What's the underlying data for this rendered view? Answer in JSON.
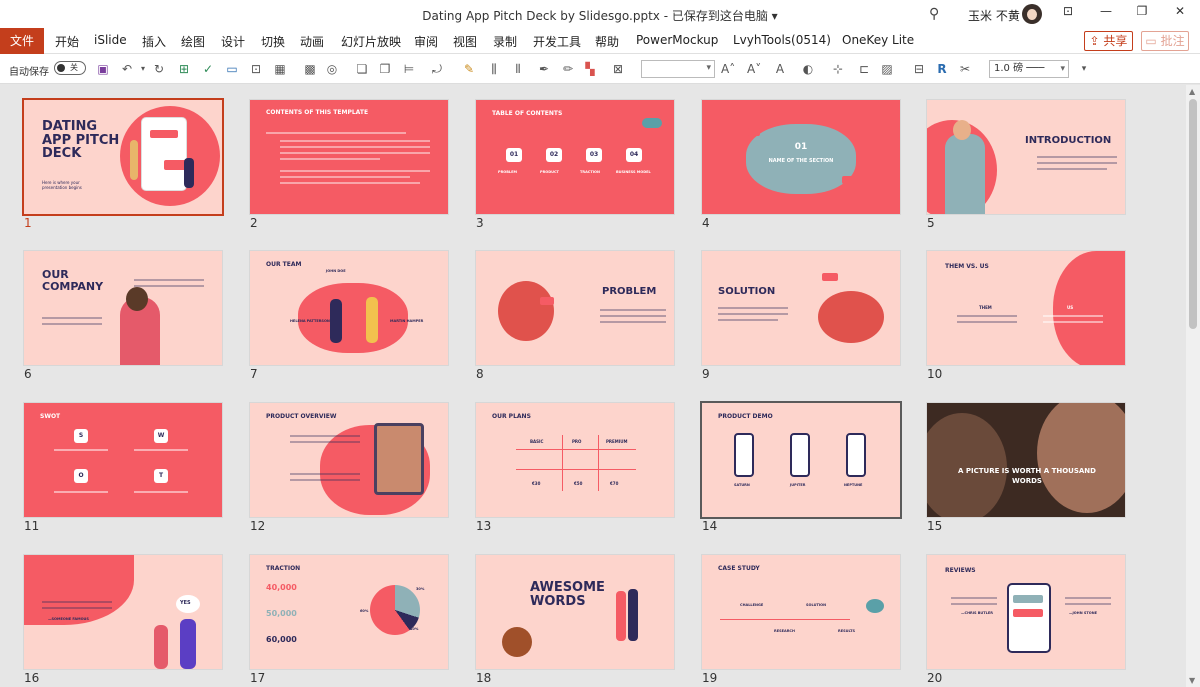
{
  "window": {
    "title": "Dating App Pitch Deck by Slidesgo.pptx  -  已保存到这台电脑 ▾",
    "user": "玉米 不黄"
  },
  "ribbon": {
    "file_tab": "文件",
    "tabs": [
      "开始",
      "iSlide",
      "插入",
      "绘图",
      "设计",
      "切换",
      "动画",
      "幻灯片放映",
      "审阅",
      "视图",
      "录制",
      "开发工具",
      "帮助",
      "PowerMockup",
      "LvyhTools(0514)",
      "OneKey Lite"
    ],
    "share": "共享",
    "comment": "批注"
  },
  "quick_toolbar": {
    "autosave_label": "自动保存",
    "autosave_state": "关",
    "line_spacing": "1.0 磅",
    "font_name": ""
  },
  "slides": [
    {
      "num": "1",
      "title": "DATING APP PITCH DECK",
      "subtitle": "Here is where your presentation begins",
      "selected": true
    },
    {
      "num": "2",
      "title": "CONTENTS OF THIS TEMPLATE"
    },
    {
      "num": "3",
      "title": "TABLE OF CONTENTS",
      "items": [
        "01",
        "02",
        "03",
        "04"
      ],
      "labels": [
        "PROBLEM",
        "PRODUCT",
        "TRACTION",
        "BUSINESS MODEL"
      ]
    },
    {
      "num": "4",
      "title": "01",
      "subtitle": "NAME OF THE SECTION"
    },
    {
      "num": "5",
      "title": "INTRODUCTION"
    },
    {
      "num": "6",
      "title": "OUR COMPANY"
    },
    {
      "num": "7",
      "title": "OUR TEAM",
      "names": [
        "JOHN DOE",
        "HELENA PATTERSON",
        "MARTIN HAMPER"
      ]
    },
    {
      "num": "8",
      "title": "PROBLEM"
    },
    {
      "num": "9",
      "title": "SOLUTION"
    },
    {
      "num": "10",
      "title": "THEM VS. US",
      "labels": [
        "THEM",
        "US"
      ]
    },
    {
      "num": "11",
      "title": "SWOT",
      "letters": [
        "S",
        "W",
        "O",
        "T"
      ]
    },
    {
      "num": "12",
      "title": "PRODUCT OVERVIEW"
    },
    {
      "num": "13",
      "title": "OUR PLANS",
      "cols": [
        "BASIC",
        "PRO",
        "PREMIUM"
      ],
      "prices": [
        "€30",
        "€50",
        "€70"
      ]
    },
    {
      "num": "14",
      "title": "PRODUCT DEMO",
      "labels": [
        "SATURN",
        "JUPITER",
        "NEPTUNE"
      ],
      "selected_secondary": true
    },
    {
      "num": "15",
      "title": "A PICTURE IS WORTH A THOUSAND WORDS"
    },
    {
      "num": "16",
      "title": "",
      "quote_author": "—SOMEONE FAMOUS",
      "speech": "YES"
    },
    {
      "num": "17",
      "title": "TRACTION",
      "stats": [
        "40,000",
        "50,000",
        "60,000"
      ],
      "pie_labels": [
        "30%",
        "60%",
        "10%"
      ]
    },
    {
      "num": "18",
      "title": "AWESOME WORDS"
    },
    {
      "num": "19",
      "title": "CASE STUDY",
      "labels": [
        "CHALLENGE",
        "SOLUTION",
        "RESEARCH",
        "RESULTS"
      ]
    },
    {
      "num": "20",
      "title": "REVIEWS",
      "authors": [
        "—CHRIS BUTLER",
        "—JOHN STONE"
      ]
    }
  ]
}
